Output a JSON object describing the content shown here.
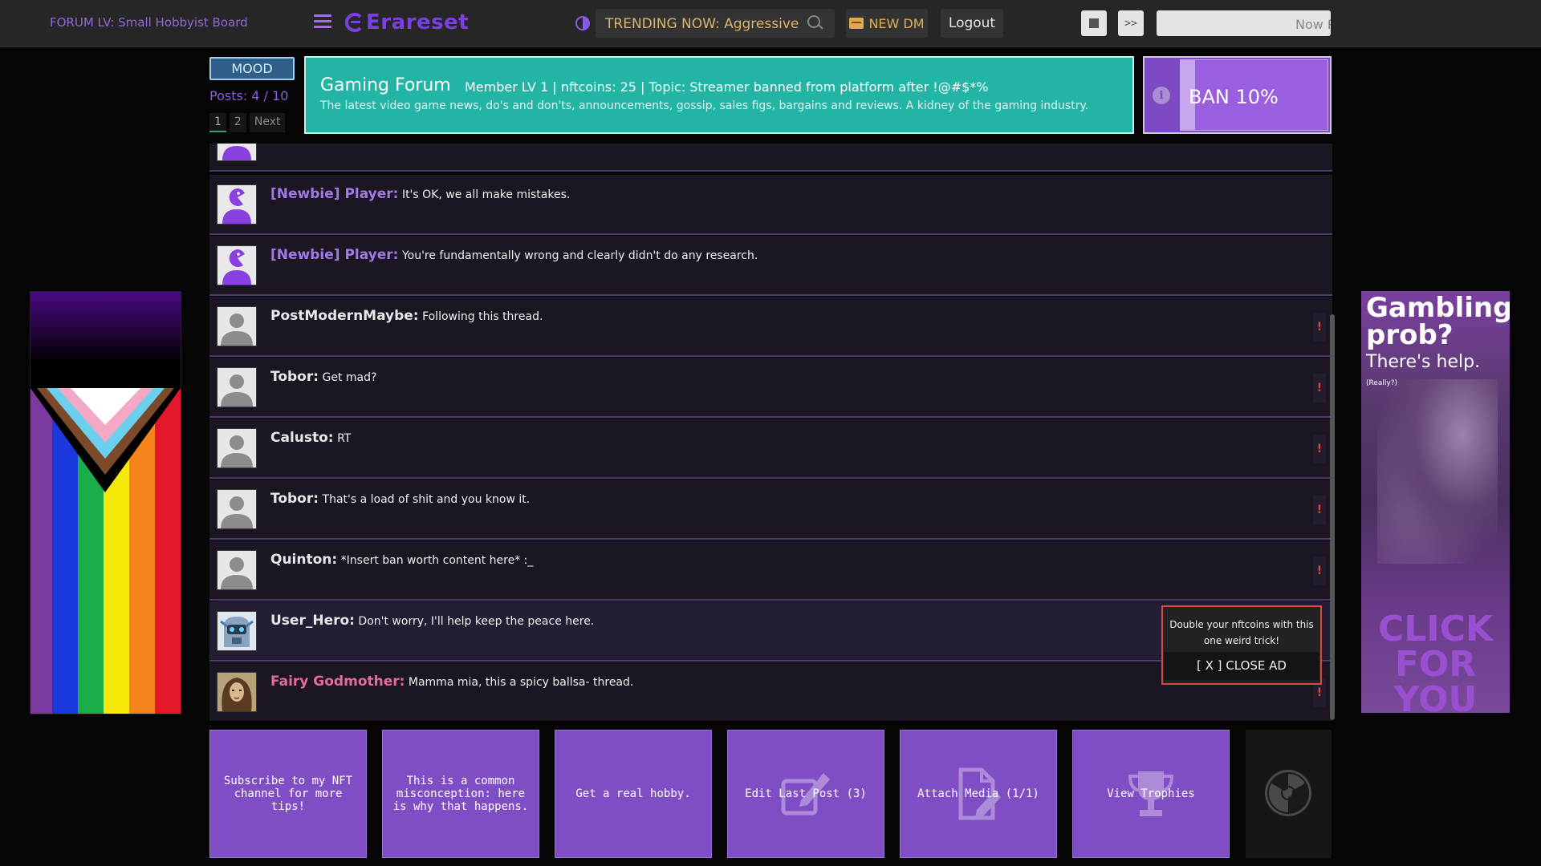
{
  "header": {
    "forum_level": "FORUM LV: Small Hobbyist Board",
    "logo": "Erareset",
    "trending": "TRENDING NOW: Aggressive",
    "new_dm": "NEW DM",
    "logout": "Logout",
    "skip": ">>",
    "now_playing": "Now Pl"
  },
  "sidebar_left": {
    "mood": "MOOD",
    "posts": "Posts: 4 / 10",
    "pages": [
      "1",
      "2"
    ],
    "next": "Next"
  },
  "forum": {
    "title": "Gaming Forum",
    "meta": "Member LV 1 | nftcoins: 25 | Topic: Streamer banned from platform after !@#$*%",
    "description": "The latest video game news, do's and don'ts, announcements, gossip, sales figs, bargains and reviews. A kidney of the gaming industry."
  },
  "ban": {
    "label": "BAN 10%",
    "percent": 10
  },
  "posts": [
    {
      "author": "[Newbie] Player:",
      "text": "It's OK, we all make mistakes.",
      "type": "newbie",
      "avatar": "purple-pacman"
    },
    {
      "author": "[Newbie] Player:",
      "text": "You're fundamentally wrong and clearly didn't do any research.",
      "type": "newbie",
      "avatar": "purple-pacman"
    },
    {
      "author": "PostModernMaybe:",
      "text": "Following this thread.",
      "type": "normal",
      "avatar": "gray-user"
    },
    {
      "author": "Tobor:",
      "text": "Get mad?",
      "type": "normal",
      "avatar": "gray-user"
    },
    {
      "author": "Calusto:",
      "text": "RT",
      "type": "normal",
      "avatar": "gray-user"
    },
    {
      "author": "Tobor:",
      "text": "That's a load of shit and you know it.",
      "type": "normal",
      "avatar": "gray-user"
    },
    {
      "author": "Quinton:",
      "text": "*Insert ban worth content here* :_",
      "type": "normal",
      "avatar": "gray-user"
    },
    {
      "author": "User_Hero:",
      "text": "Don't worry, I'll help keep the peace here.",
      "type": "hero",
      "avatar": "robot"
    },
    {
      "author": "Fairy Godmother:",
      "text": "Mamma mia, this a spicy ballsa- thread.",
      "type": "fairy",
      "avatar": "fairy"
    }
  ],
  "report_flag": "!",
  "ad_popup": {
    "text": "Double your nftcoins with this one weird trick!",
    "close": "[ X ] CLOSE AD"
  },
  "gamble_ad": {
    "title": "Gambling prob?",
    "sub": "There's help.",
    "small": "(Really?)",
    "cta": "CLICK FOR YOU"
  },
  "actions": [
    {
      "label": "Subscribe to my NFT channel for more tips!",
      "icon": "none"
    },
    {
      "label": "This is a common misconception: here is why that happens.",
      "icon": "none"
    },
    {
      "label": "Get a real hobby.",
      "icon": "none"
    },
    {
      "label": "Edit Last Post (3)",
      "icon": "edit-icon"
    },
    {
      "label": "Attach Media (1/1)",
      "icon": "attach-file-icon"
    },
    {
      "label": "View Trophies",
      "icon": "trophy-icon"
    }
  ],
  "colors": {
    "accent": "#7b3fe0",
    "banner": "#22b5a5",
    "action": "#7f4dc4",
    "trending": "#d9b46a",
    "alert": "#e0443a"
  }
}
